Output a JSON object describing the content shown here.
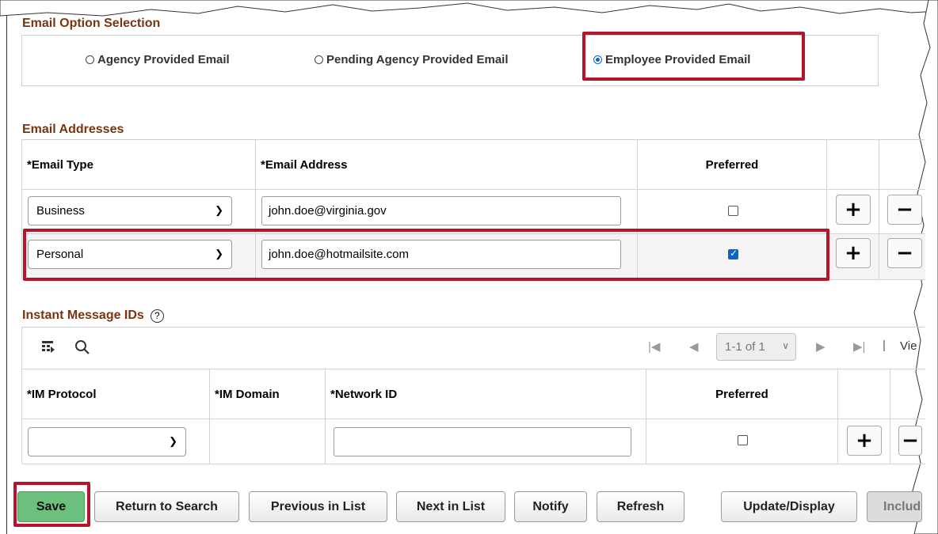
{
  "email_option": {
    "title": "Email Option Selection",
    "options": [
      {
        "label": "Agency Provided Email",
        "selected": false
      },
      {
        "label": "Pending Agency Provided Email",
        "selected": false
      },
      {
        "label": "Employee Provided Email",
        "selected": true
      }
    ]
  },
  "email_addresses": {
    "title": "Email Addresses",
    "headers": {
      "type": "*Email Type",
      "address": "*Email Address",
      "preferred": "Preferred"
    },
    "rows": [
      {
        "type": "Business",
        "address": "john.doe@virginia.gov",
        "preferred": false
      },
      {
        "type": "Personal",
        "address": "john.doe@hotmailsite.com",
        "preferred": true
      }
    ]
  },
  "instant_messages": {
    "title": "Instant Message IDs",
    "pager": {
      "range": "1-1 of 1",
      "view": "Vie"
    },
    "headers": {
      "protocol": "*IM Protocol",
      "domain": "*IM Domain",
      "network": "*Network ID",
      "preferred": "Preferred"
    },
    "rows": [
      {
        "protocol": "",
        "domain": "",
        "network": "",
        "preferred": false
      }
    ]
  },
  "buttons": {
    "save": "Save",
    "return": "Return to Search",
    "previous": "Previous in List",
    "next": "Next in List",
    "notify": "Notify",
    "refresh": "Refresh",
    "update": "Update/Display",
    "include": "Includ"
  },
  "colors": {
    "highlight": "#b5152b",
    "section_title": "#7a3410",
    "save_button": "#6cc07e",
    "checkbox": "#0a63c9"
  }
}
